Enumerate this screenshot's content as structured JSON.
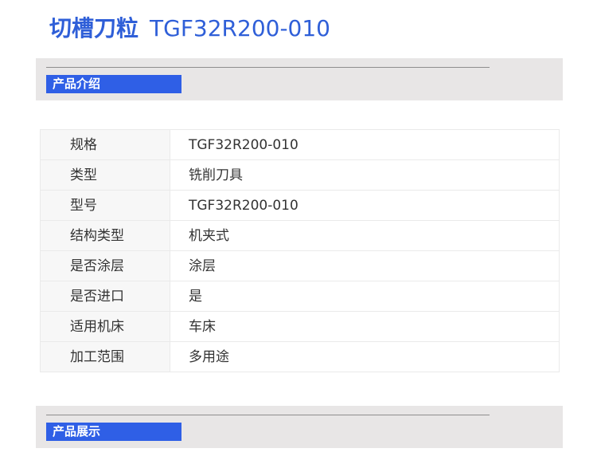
{
  "header": {
    "name": "切槽刀粒",
    "model": "TGF32R200-010"
  },
  "section_intro": {
    "label": "产品介绍"
  },
  "specs": [
    {
      "key": "规格",
      "value": "TGF32R200-010"
    },
    {
      "key": "类型",
      "value": "铣削刀具"
    },
    {
      "key": "型号",
      "value": "TGF32R200-010"
    },
    {
      "key": "结构类型",
      "value": "机夹式"
    },
    {
      "key": "是否涂层",
      "value": "涂层"
    },
    {
      "key": "是否进口",
      "value": "是"
    },
    {
      "key": "适用机床",
      "value": "车床"
    },
    {
      "key": "加工范围",
      "value": "多用途"
    }
  ],
  "section_display": {
    "label": "产品展示"
  },
  "colors": {
    "accent": "#2f5fe6",
    "title": "#2f5fd8",
    "section_bg": "#e8e6e6"
  }
}
